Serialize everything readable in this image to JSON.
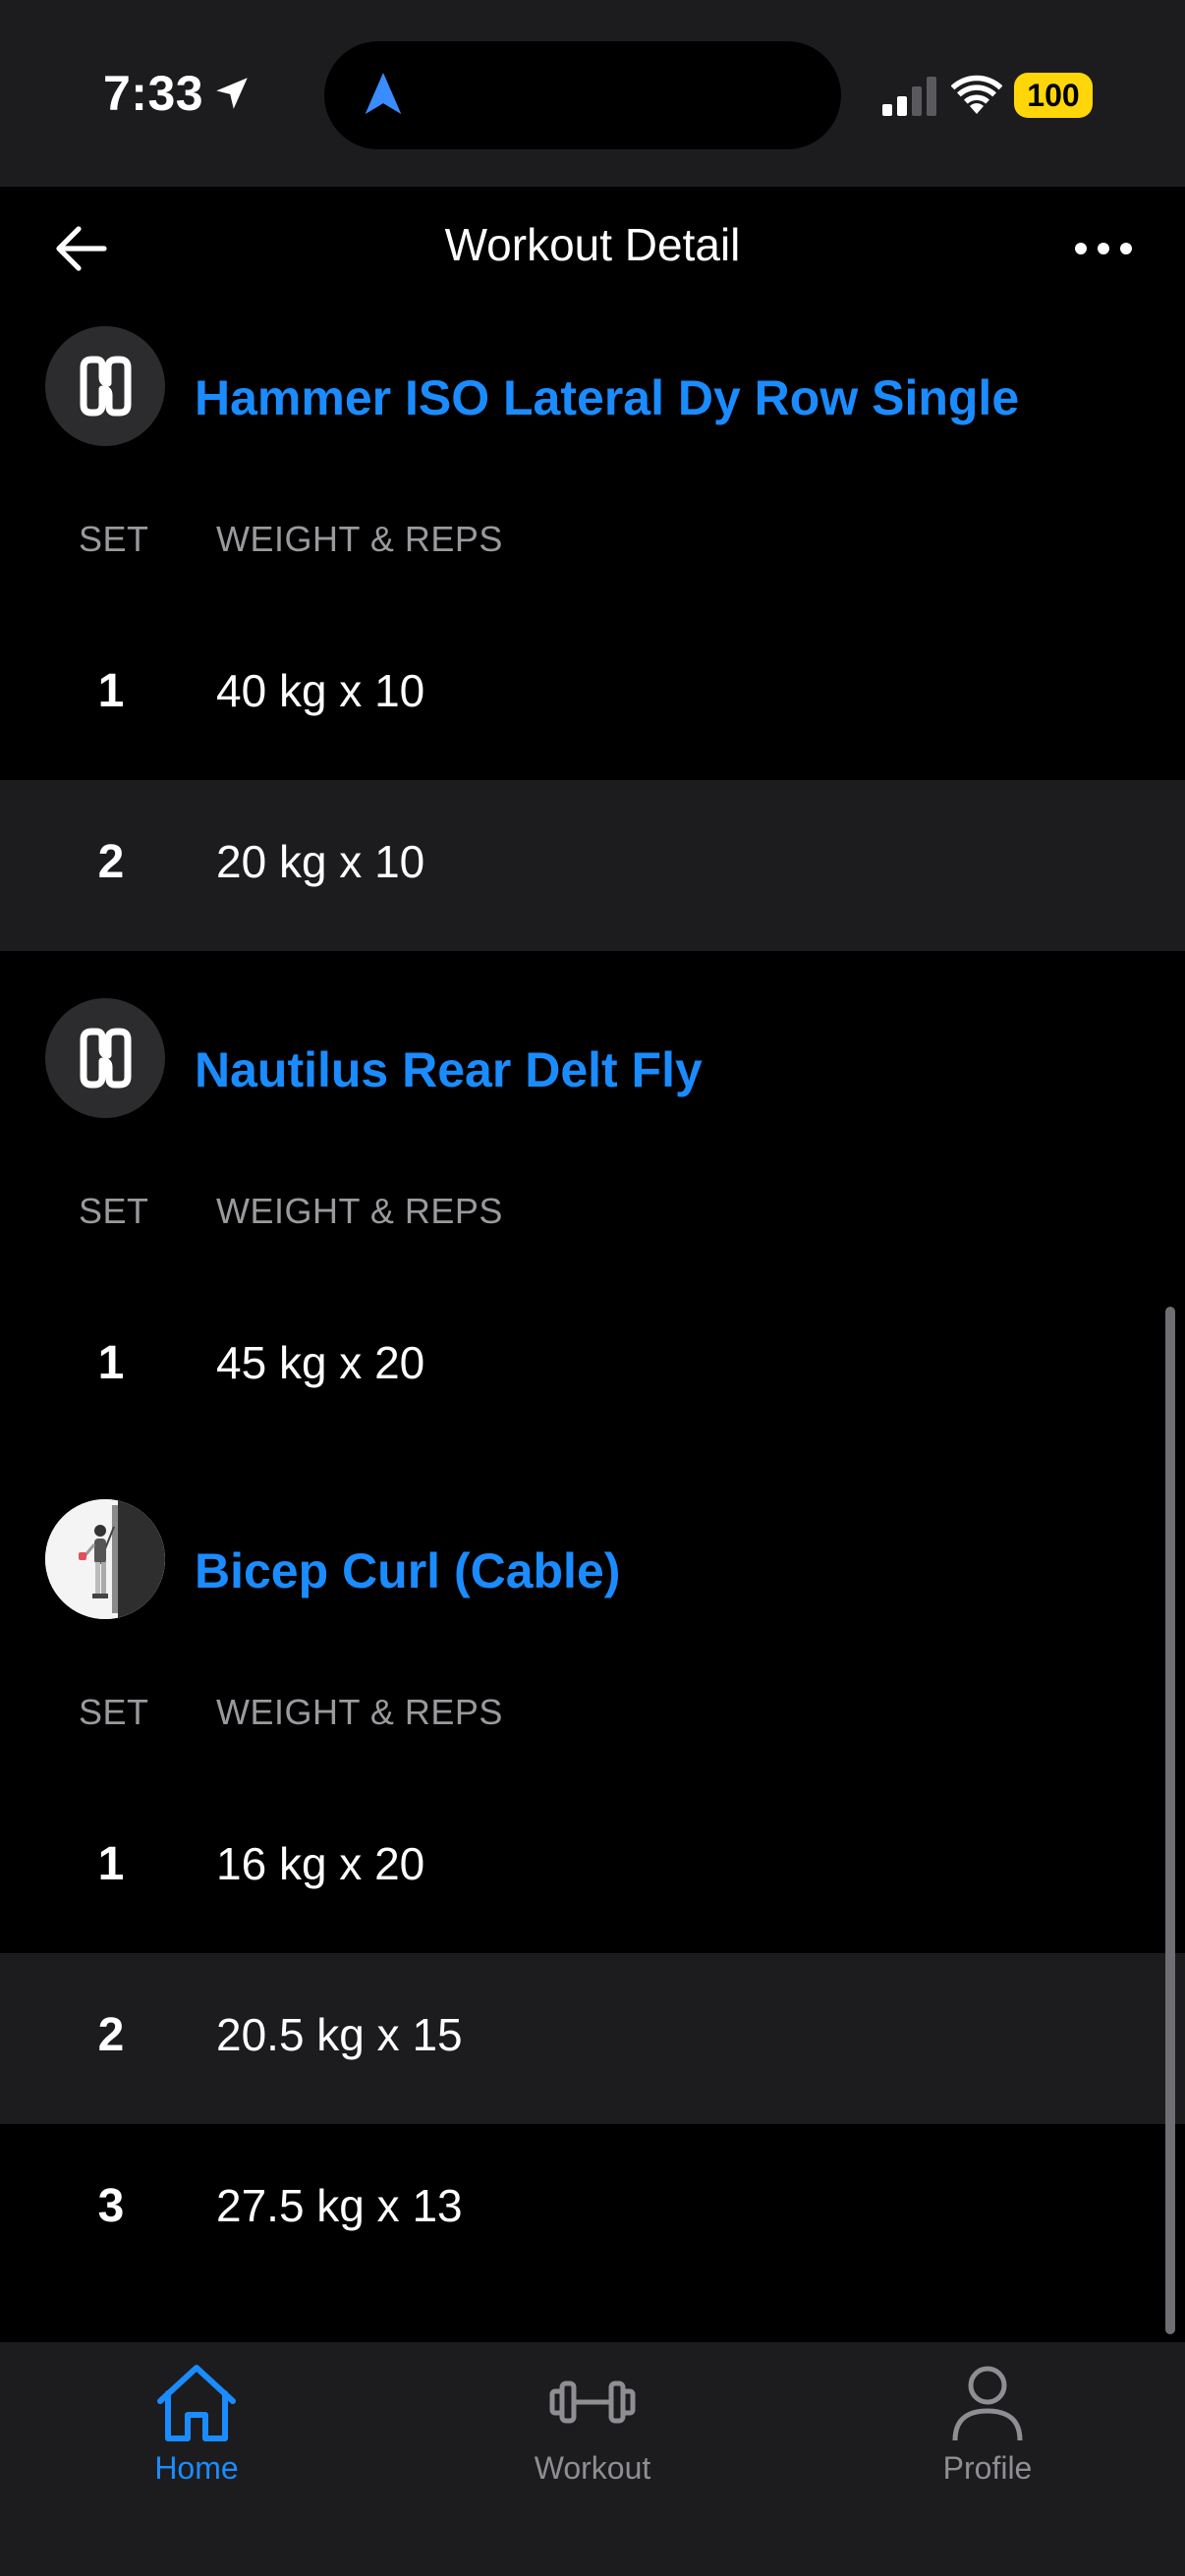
{
  "status_bar": {
    "time": "7:33",
    "battery": "100",
    "icons": [
      "location-arrow-icon",
      "navigation-icon",
      "cellular-signal-icon",
      "wifi-icon",
      "battery-icon"
    ]
  },
  "header": {
    "title": "Workout Detail",
    "back_icon": "arrow-left-icon",
    "more_icon": "ellipsis-icon"
  },
  "column_labels": {
    "set": "SET",
    "weight_reps": "WEIGHT & REPS"
  },
  "exercises": [
    {
      "name": "Hammer ISO Lateral Dy Row Single",
      "icon": "hevy-logo-icon",
      "sets": [
        {
          "set": "1",
          "value": "40 kg x 10"
        },
        {
          "set": "2",
          "value": "20 kg x 10"
        }
      ]
    },
    {
      "name": "Nautilus Rear Delt Fly",
      "icon": "hevy-logo-icon",
      "sets": [
        {
          "set": "1",
          "value": "45 kg x 20"
        }
      ]
    },
    {
      "name": "Bicep Curl (Cable)",
      "icon": "exercise-thumbnail",
      "sets": [
        {
          "set": "1",
          "value": "16 kg x 20"
        },
        {
          "set": "2",
          "value": "20.5 kg x 15"
        },
        {
          "set": "3",
          "value": "27.5 kg x 13"
        }
      ]
    }
  ],
  "tab_bar": {
    "tabs": [
      {
        "label": "Home",
        "icon": "home-icon",
        "active": true
      },
      {
        "label": "Workout",
        "icon": "dumbbell-icon",
        "active": false
      },
      {
        "label": "Profile",
        "icon": "person-icon",
        "active": false
      }
    ]
  },
  "colors": {
    "accent": "#1a8cff",
    "background": "#000000",
    "surface": "#1c1c1e",
    "battery": "#ffd60a"
  }
}
